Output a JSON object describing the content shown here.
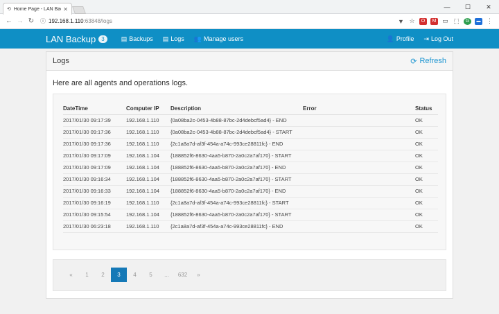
{
  "browser": {
    "tab_title": "Home Page - LAN Backu",
    "url_host": "192.168.1.110",
    "url_path": ":63848/logs"
  },
  "navbar": {
    "brand": "LAN Backup",
    "badge": "3",
    "links": [
      "Backups",
      "Logs",
      "Manage users"
    ],
    "profile": "Profile",
    "logout": "Log Out"
  },
  "panel": {
    "title": "Logs",
    "refresh": "Refresh",
    "intro": "Here are all agents and operations logs."
  },
  "table": {
    "headers": [
      "DateTime",
      "Computer IP",
      "Description",
      "Error",
      "Status"
    ],
    "rows": [
      [
        "2017/01/30 09:17:39",
        "192.168.1.110",
        "{0a08ba2c-0453-4b88-87bc-2d4debcf5ad4} - END",
        "",
        "OK"
      ],
      [
        "2017/01/30 09:17:36",
        "192.168.1.110",
        "{0a08ba2c-0453-4b88-87bc-2d4debcf5ad4} - START",
        "",
        "OK"
      ],
      [
        "2017/01/30 09:17:36",
        "192.168.1.110",
        "{2c1a8a7d-af3f-454a-a74c-993ce28811fc} - END",
        "",
        "OK"
      ],
      [
        "2017/01/30 09:17:09",
        "192.168.1.104",
        "{188852f6-8630-4aa5-b870-2a0c2a7af170} - START",
        "",
        "OK"
      ],
      [
        "2017/01/30 09:17:09",
        "192.168.1.104",
        "{188852f6-8630-4aa5-b870-2a0c2a7af170} - END",
        "",
        "OK"
      ],
      [
        "2017/01/30 09:16:34",
        "192.168.1.104",
        "{188852f6-8630-4aa5-b870-2a0c2a7af170} - START",
        "",
        "OK"
      ],
      [
        "2017/01/30 09:16:33",
        "192.168.1.104",
        "{188852f6-8630-4aa5-b870-2a0c2a7af170} - END",
        "",
        "OK"
      ],
      [
        "2017/01/30 09:16:19",
        "192.168.1.110",
        "{2c1a8a7d-af3f-454a-a74c-993ce28811fc} - START",
        "",
        "OK"
      ],
      [
        "2017/01/30 09:15:54",
        "192.168.1.104",
        "{188852f6-8630-4aa5-b870-2a0c2a7af170} - START",
        "",
        "OK"
      ],
      [
        "2017/01/30 06:23:18",
        "192.168.1.110",
        "{2c1a8a7d-af3f-454a-a74c-993ce28811fc} - END",
        "",
        "OK"
      ]
    ]
  },
  "pagination": {
    "items": [
      "«",
      "1",
      "2",
      "3",
      "4",
      "5",
      "...",
      "632",
      "»"
    ],
    "active": "3"
  },
  "colors": {
    "navbar": "#0f8fc5",
    "accent": "#1c95d1",
    "active_page": "#1579b7"
  }
}
